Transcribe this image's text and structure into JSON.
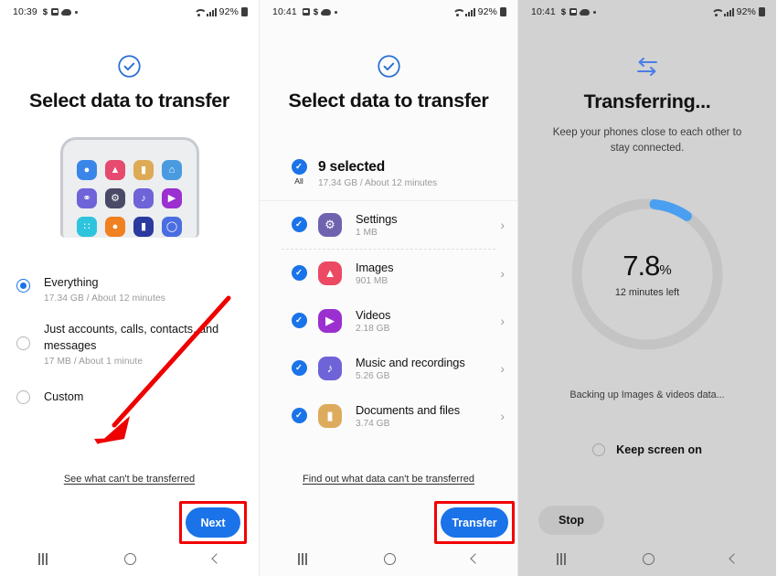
{
  "panels": [
    {
      "id": "select-data-everything",
      "status_bar": {
        "time": "10:39",
        "battery": "92%",
        "icons": [
          "dollar-icon",
          "photo-icon",
          "cloud-icon",
          "dot-icon",
          "wifi-icon",
          "signal-icon",
          "battery-icon"
        ]
      },
      "header": {
        "icon": "check-circle-icon",
        "title": "Select data to transfer"
      },
      "illustration": {
        "name": "phone-illustration",
        "apps": [
          {
            "name": "messages-icon",
            "glyph": "●",
            "color": "#3a86e8"
          },
          {
            "name": "gallery-icon",
            "glyph": "▲",
            "color": "#e64a6e"
          },
          {
            "name": "documents-icon",
            "glyph": "▮",
            "color": "#ddaa55"
          },
          {
            "name": "home-icon",
            "glyph": "⌂",
            "color": "#4a9ae0"
          },
          {
            "name": "keys-icon",
            "glyph": "⚷",
            "color": "#6f63d8"
          },
          {
            "name": "settings-icon",
            "glyph": "⚙",
            "color": "#4a4a66"
          },
          {
            "name": "music-icon",
            "glyph": "♪",
            "color": "#6f63d8"
          },
          {
            "name": "video-icon",
            "glyph": "▶",
            "color": "#9b2fd0"
          },
          {
            "name": "apps-icon",
            "glyph": "∷",
            "color": "#2ec4de"
          },
          {
            "name": "contacts-icon",
            "glyph": "●",
            "color": "#f08020"
          },
          {
            "name": "files-icon",
            "glyph": "▮",
            "color": "#2b3a9e"
          },
          {
            "name": "watch-icon",
            "glyph": "○",
            "color": "#4a6ee0"
          }
        ]
      },
      "options": [
        {
          "label": "Everything",
          "sub": "17.34 GB / About 12 minutes",
          "selected": true
        },
        {
          "label": "Just accounts, calls, contacts, and messages",
          "sub": "17 MB / About 1 minute",
          "selected": false
        },
        {
          "label": "Custom",
          "sub": "",
          "selected": false
        }
      ],
      "footer_link": "See what can't be transferred",
      "cta": "Next",
      "cta_highlighted": true,
      "annotation": {
        "type": "arrow",
        "color": "#ee0000"
      }
    },
    {
      "id": "select-data-custom",
      "status_bar": {
        "time": "10:41",
        "battery": "92%",
        "icons": [
          "photo-icon",
          "dollar-icon",
          "cloud-icon",
          "dot-icon",
          "wifi-icon",
          "signal-icon",
          "battery-icon"
        ]
      },
      "header": {
        "icon": "check-circle-icon",
        "title": "Select data to transfer"
      },
      "summary": {
        "checkbox_label": "All",
        "checked": true,
        "title": "9 selected",
        "sub": "17.34 GB / About 12 minutes"
      },
      "items": [
        {
          "name": "settings",
          "title": "Settings",
          "size": "1 MB",
          "checked": true,
          "icon": "settings-icon",
          "glyph": "⚙",
          "color": "#6f63b0"
        },
        {
          "name": "images",
          "title": "Images",
          "size": "901 MB",
          "checked": true,
          "icon": "gallery-icon",
          "glyph": "▲",
          "color": "#ec4a64"
        },
        {
          "name": "videos",
          "title": "Videos",
          "size": "2.18 GB",
          "checked": true,
          "icon": "video-icon",
          "glyph": "▶",
          "color": "#9b2fd0"
        },
        {
          "name": "music",
          "title": "Music and recordings",
          "size": "5.26 GB",
          "checked": true,
          "icon": "music-icon",
          "glyph": "♪",
          "color": "#6f63d8"
        },
        {
          "name": "documents",
          "title": "Documents and files",
          "size": "3.74 GB",
          "checked": true,
          "icon": "documents-icon",
          "glyph": "▮",
          "color": "#ddab5e"
        }
      ],
      "footer_link": "Find out what data can't be transferred",
      "cta": "Transfer",
      "cta_highlighted": true
    },
    {
      "id": "transferring",
      "status_bar": {
        "time": "10:41",
        "battery": "92%",
        "icons": [
          "dollar-icon",
          "photo-icon",
          "cloud-icon",
          "dot-icon",
          "wifi-icon",
          "signal-icon",
          "battery-icon"
        ]
      },
      "header": {
        "icon": "transfer-arrows-icon",
        "title": "Transferring..."
      },
      "subtitle": "Keep your phones close to each other to stay connected.",
      "progress": {
        "percent": "7.8",
        "percent_symbol": "%",
        "value": 7.8,
        "time_left": "12 minutes left"
      },
      "status_text": "Backing up Images & videos data...",
      "keep_screen_on": {
        "label": "Keep screen on",
        "checked": false
      },
      "stop_button": "Stop"
    }
  ],
  "nav_bar": {
    "recents": "recents-icon",
    "home": "home-icon",
    "back": "back-icon"
  },
  "colors": {
    "accent": "#1a73e8",
    "annotation": "#ee0000",
    "panel3_bg": "#d2d2d2",
    "progress_track": "#c4c4c4"
  }
}
